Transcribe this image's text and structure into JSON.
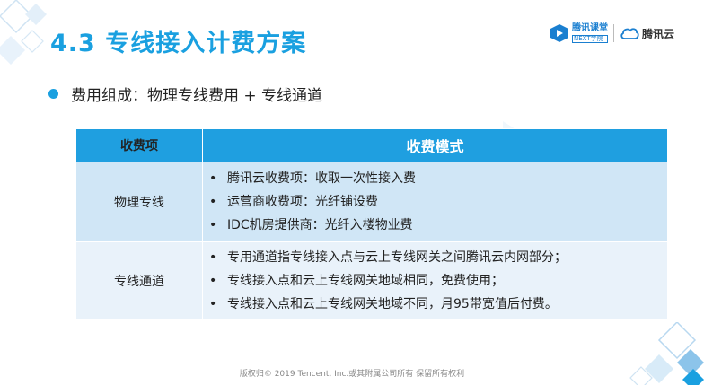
{
  "title": "4.3 专线接入计费方案",
  "logos": {
    "ketang_cn": "腾讯课堂",
    "ketang_en": "NEXT学院",
    "tencent_cloud": "腾讯云"
  },
  "bullet": "费用组成：物理专线费用 + 专线通道",
  "table": {
    "headers": [
      "收费项",
      "收费模式"
    ],
    "rows": [
      {
        "item": "物理专线",
        "modes": [
          "腾讯云收费项：收取一次性接入费",
          "运营商收费项：光纤铺设费",
          "IDC机房提供商：光纤入楼物业费"
        ]
      },
      {
        "item": "专线通道",
        "modes": [
          "专用通道指专线接入点与云上专线网关之间腾讯云内网部分；",
          "专线接入点和云上专线网关地域相同，免费使用；",
          "专线接入点和云上专线网关地域不同，月95带宽值后付费。"
        ]
      }
    ]
  },
  "footer": "版权归© 2019 Tencent, Inc.或其附属公司所有 保留所有权利",
  "colors": {
    "accent": "#1aa0e0",
    "header_bg": "#1f9fe0",
    "row1_bg": "#d0e6f6",
    "row2_bg": "#e9f2fa"
  }
}
